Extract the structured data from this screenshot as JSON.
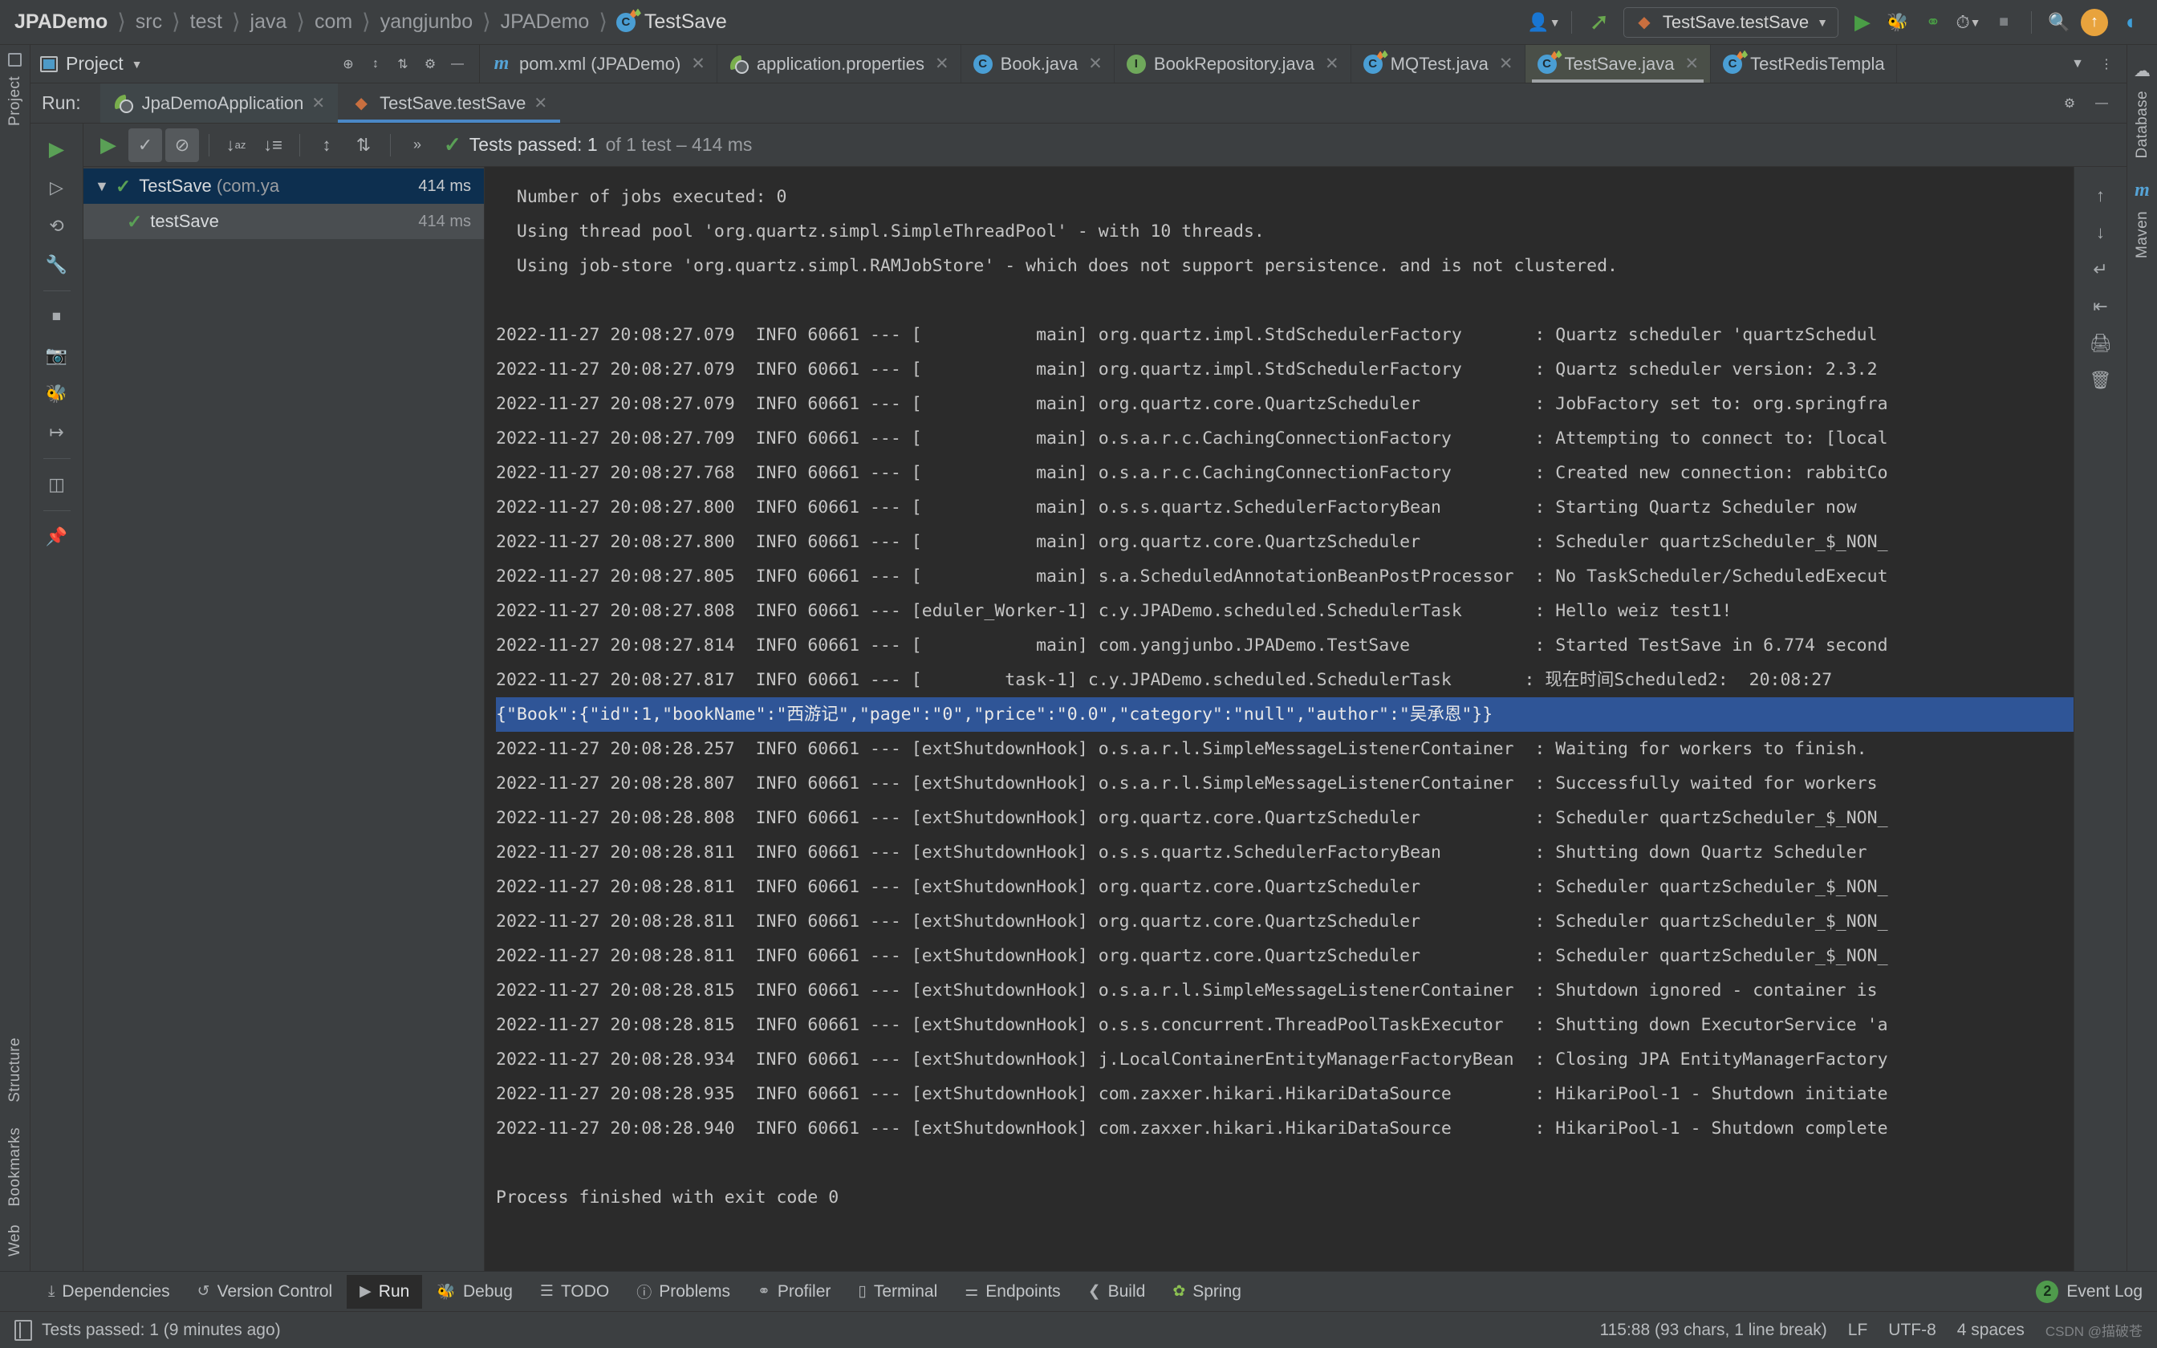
{
  "window": {
    "breadcrumb": [
      "JPADemo",
      "src",
      "test",
      "java",
      "com",
      "yangjunbo",
      "JPADemo",
      "TestSave"
    ],
    "breadcrumb_leaf_icon": "java-class-test-icon"
  },
  "toolbar": {
    "profile_icon": "user-profile-icon",
    "updates_icon": "update-arrow-icon",
    "run_config": "TestSave.testSave",
    "run_icon": "run-icon",
    "debug_icon": "debug-icon",
    "run_coverage_icon": "run-with-coverage-icon",
    "profiler_icon": "profiler-icon",
    "stop_icon": "stop-icon",
    "search_icon": "search-everywhere-icon",
    "notification_icon": "notification-arrow-icon",
    "ide_icon": "ide-logo-icon"
  },
  "project_panel": {
    "title": "Project",
    "dropdown_icon": "chevron-down-icon",
    "tools": [
      "locate-icon",
      "expand-all-icon",
      "collapse-all-icon",
      "gear-icon",
      "hide-icon"
    ]
  },
  "editor_tabs": [
    {
      "label": "pom.xml (JPADemo)",
      "icon": "maven-file-icon",
      "active": false
    },
    {
      "label": "application.properties",
      "icon": "spring-properties-icon",
      "active": false
    },
    {
      "label": "Book.java",
      "icon": "java-class-icon",
      "active": false
    },
    {
      "label": "BookRepository.java",
      "icon": "java-interface-icon",
      "active": false
    },
    {
      "label": "MQTest.java",
      "icon": "java-class-test-icon",
      "active": false
    },
    {
      "label": "TestSave.java",
      "icon": "java-class-test-icon",
      "active": true
    },
    {
      "label": "TestRedisTempla",
      "icon": "java-class-test-icon",
      "active": false
    }
  ],
  "editor_tabs_end": {
    "chevron": "chevron-down-icon",
    "more": "more-options-icon"
  },
  "run_window": {
    "label": "Run:",
    "tabs": [
      {
        "label": "JpaDemoApplication",
        "icon": "spring-boot-icon",
        "selected": false
      },
      {
        "label": "TestSave.testSave",
        "icon": "junit-test-icon",
        "selected": true
      }
    ],
    "settings_icon": "gear-icon",
    "hide_icon": "hide-icon"
  },
  "run_left_tools": [
    "rerun-icon",
    "rerun-failed-icon",
    "rerun-auto-icon",
    "wrench-icon",
    "stop-icon",
    "dump-threads-icon",
    "debug-icon",
    "export-icon",
    "layout-icon",
    "pin-icon"
  ],
  "test_toolbar": {
    "rerun_icon": "rerun-icon",
    "show_passed_icon": "show-passed-icon",
    "show_ignored_icon": "show-ignored-icon",
    "sort_alpha_icon": "sort-alphabetically-icon",
    "sort_duration_icon": "sort-by-duration-icon",
    "expand_all_icon": "expand-all-icon",
    "collapse_all_icon": "collapse-all-icon",
    "more_icon": "more-options-icon",
    "status_check_icon": "check-icon",
    "status_main": "Tests passed: 1",
    "status_dim": "of 1 test – 414 ms"
  },
  "test_tree": [
    {
      "name": "TestSave",
      "package": "(com.ya",
      "time": "414 ms",
      "selected": true,
      "child": false,
      "status_icon": "check-icon",
      "chevron": "chevron-down-icon"
    },
    {
      "name": "testSave",
      "package": "",
      "time": "414 ms",
      "selected": false,
      "child": true,
      "status_icon": "check-icon",
      "chevron": ""
    }
  ],
  "console": {
    "lines": [
      {
        "text": "  Number of jobs executed: 0",
        "highlight": false
      },
      {
        "text": "  Using thread pool 'org.quartz.simpl.SimpleThreadPool' - with 10 threads.",
        "highlight": false
      },
      {
        "text": "  Using job-store 'org.quartz.simpl.RAMJobStore' - which does not support persistence. and is not clustered.",
        "highlight": false
      },
      {
        "text": "",
        "highlight": false
      },
      {
        "text": "2022-11-27 20:08:27.079  INFO 60661 --- [           main] org.quartz.impl.StdSchedulerFactory       : Quartz scheduler 'quartzSchedul",
        "highlight": false
      },
      {
        "text": "2022-11-27 20:08:27.079  INFO 60661 --- [           main] org.quartz.impl.StdSchedulerFactory       : Quartz scheduler version: 2.3.2",
        "highlight": false
      },
      {
        "text": "2022-11-27 20:08:27.079  INFO 60661 --- [           main] org.quartz.core.QuartzScheduler           : JobFactory set to: org.springfra",
        "highlight": false
      },
      {
        "text": "2022-11-27 20:08:27.709  INFO 60661 --- [           main] o.s.a.r.c.CachingConnectionFactory        : Attempting to connect to: [local",
        "highlight": false
      },
      {
        "text": "2022-11-27 20:08:27.768  INFO 60661 --- [           main] o.s.a.r.c.CachingConnectionFactory        : Created new connection: rabbitCo",
        "highlight": false
      },
      {
        "text": "2022-11-27 20:08:27.800  INFO 60661 --- [           main] o.s.s.quartz.SchedulerFactoryBean         : Starting Quartz Scheduler now",
        "highlight": false
      },
      {
        "text": "2022-11-27 20:08:27.800  INFO 60661 --- [           main] org.quartz.core.QuartzScheduler           : Scheduler quartzScheduler_$_NON_",
        "highlight": false
      },
      {
        "text": "2022-11-27 20:08:27.805  INFO 60661 --- [           main] s.a.ScheduledAnnotationBeanPostProcessor  : No TaskScheduler/ScheduledExecut",
        "highlight": false
      },
      {
        "text": "2022-11-27 20:08:27.808  INFO 60661 --- [eduler_Worker-1] c.y.JPADemo.scheduled.SchedulerTask       : Hello weiz test1!",
        "highlight": false
      },
      {
        "text": "2022-11-27 20:08:27.814  INFO 60661 --- [           main] com.yangjunbo.JPADemo.TestSave            : Started TestSave in 6.774 second",
        "highlight": false
      },
      {
        "text": "2022-11-27 20:08:27.817  INFO 60661 --- [        task-1] c.y.JPADemo.scheduled.SchedulerTask       : 现在时间Scheduled2:  20:08:27",
        "highlight": false
      },
      {
        "text": "{\"Book\":{\"id\":1,\"bookName\":\"西游记\",\"page\":\"0\",\"price\":\"0.0\",\"category\":\"null\",\"author\":\"吴承恩\"}}",
        "highlight": true
      },
      {
        "text": "2022-11-27 20:08:28.257  INFO 60661 --- [extShutdownHook] o.s.a.r.l.SimpleMessageListenerContainer  : Waiting for workers to finish.",
        "highlight": false
      },
      {
        "text": "2022-11-27 20:08:28.807  INFO 60661 --- [extShutdownHook] o.s.a.r.l.SimpleMessageListenerContainer  : Successfully waited for workers",
        "highlight": false
      },
      {
        "text": "2022-11-27 20:08:28.808  INFO 60661 --- [extShutdownHook] org.quartz.core.QuartzScheduler           : Scheduler quartzScheduler_$_NON_",
        "highlight": false
      },
      {
        "text": "2022-11-27 20:08:28.811  INFO 60661 --- [extShutdownHook] o.s.s.quartz.SchedulerFactoryBean         : Shutting down Quartz Scheduler",
        "highlight": false
      },
      {
        "text": "2022-11-27 20:08:28.811  INFO 60661 --- [extShutdownHook] org.quartz.core.QuartzScheduler           : Scheduler quartzScheduler_$_NON_",
        "highlight": false
      },
      {
        "text": "2022-11-27 20:08:28.811  INFO 60661 --- [extShutdownHook] org.quartz.core.QuartzScheduler           : Scheduler quartzScheduler_$_NON_",
        "highlight": false
      },
      {
        "text": "2022-11-27 20:08:28.811  INFO 60661 --- [extShutdownHook] org.quartz.core.QuartzScheduler           : Scheduler quartzScheduler_$_NON_",
        "highlight": false
      },
      {
        "text": "2022-11-27 20:08:28.815  INFO 60661 --- [extShutdownHook] o.s.a.r.l.SimpleMessageListenerContainer  : Shutdown ignored - container is",
        "highlight": false
      },
      {
        "text": "2022-11-27 20:08:28.815  INFO 60661 --- [extShutdownHook] o.s.s.concurrent.ThreadPoolTaskExecutor   : Shutting down ExecutorService 'a",
        "highlight": false
      },
      {
        "text": "2022-11-27 20:08:28.934  INFO 60661 --- [extShutdownHook] j.LocalContainerEntityManagerFactoryBean  : Closing JPA EntityManagerFactory",
        "highlight": false
      },
      {
        "text": "2022-11-27 20:08:28.935  INFO 60661 --- [extShutdownHook] com.zaxxer.hikari.HikariDataSource        : HikariPool-1 - Shutdown initiate",
        "highlight": false
      },
      {
        "text": "2022-11-27 20:08:28.940  INFO 60661 --- [extShutdownHook] com.zaxxer.hikari.HikariDataSource        : HikariPool-1 - Shutdown complete",
        "highlight": false
      },
      {
        "text": "",
        "highlight": false
      },
      {
        "text": "Process finished with exit code 0",
        "highlight": false
      }
    ]
  },
  "console_right_tools": [
    "scroll-up-icon",
    "scroll-down-icon",
    "soft-wrap-icon",
    "scroll-to-end-icon",
    "print-icon",
    "clear-all-icon"
  ],
  "left_rail": {
    "top": "Project",
    "middle": [
      "Structure",
      "Bookmarks"
    ],
    "bottom": "Web"
  },
  "right_rail": {
    "items": [
      "Database",
      "Maven"
    ]
  },
  "bottom_bar": {
    "items": [
      {
        "label": "Dependencies",
        "icon": "dependencies-icon",
        "active": false
      },
      {
        "label": "Version Control",
        "icon": "version-control-icon",
        "active": false
      },
      {
        "label": "Run",
        "icon": "run-icon",
        "active": true
      },
      {
        "label": "Debug",
        "icon": "debug-icon",
        "active": false
      },
      {
        "label": "TODO",
        "icon": "todo-icon",
        "active": false
      },
      {
        "label": "Problems",
        "icon": "problems-icon",
        "active": false
      },
      {
        "label": "Profiler",
        "icon": "profiler-icon",
        "active": false
      },
      {
        "label": "Terminal",
        "icon": "terminal-icon",
        "active": false
      },
      {
        "label": "Endpoints",
        "icon": "endpoints-icon",
        "active": false
      },
      {
        "label": "Build",
        "icon": "build-icon",
        "active": false
      },
      {
        "label": "Spring",
        "icon": "spring-icon",
        "active": false
      }
    ],
    "event_log": {
      "label": "Event Log",
      "count": "2"
    }
  },
  "status_bar": {
    "message": "Tests passed: 1 (9 minutes ago)",
    "caret": "115:88 (93 chars, 1 line break)",
    "line_sep": "LF",
    "encoding": "UTF-8",
    "indent": "4 spaces",
    "watermark": "CSDN @描破苍"
  },
  "colors": {
    "accent_blue": "#2f5597",
    "tab_selected": "#4a4f48",
    "console_bg": "#2b2b2b",
    "panel_bg": "#3c3f41",
    "green": "#5aa056"
  }
}
